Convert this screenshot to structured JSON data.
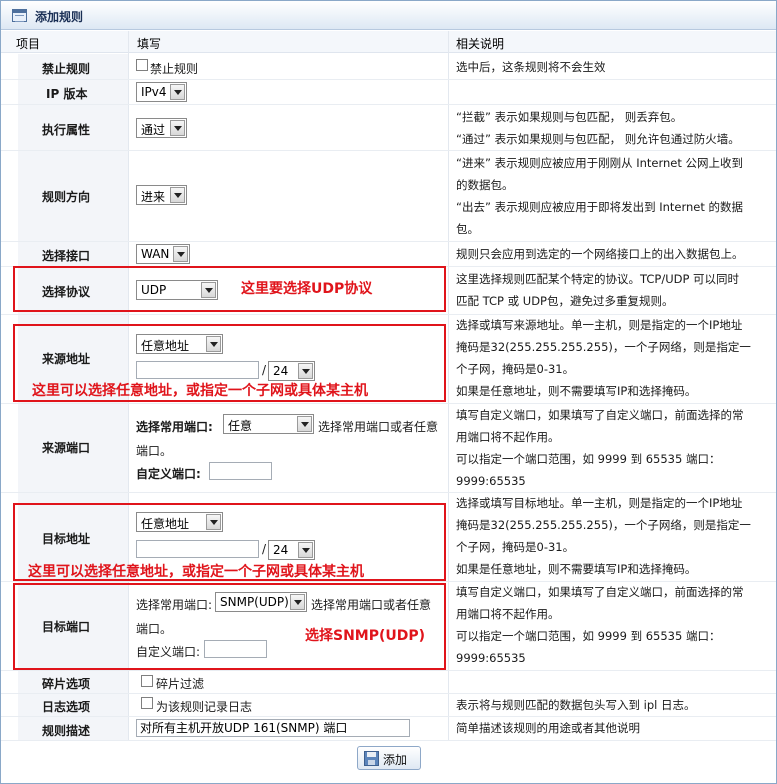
{
  "window": {
    "title": "添加规则"
  },
  "columns": {
    "item": "项目",
    "fill": "填写",
    "desc": "相关说明"
  },
  "rows": {
    "disable": {
      "label": "禁止规则",
      "checkbox_label": "禁止规则",
      "checked": false,
      "desc": [
        "选中后，这条规则将不会生效"
      ]
    },
    "ipversion": {
      "label": "IP 版本",
      "value": "IPv4"
    },
    "action": {
      "label": "执行属性",
      "value": "通过",
      "desc": [
        "“拦截” 表示如果规则与包匹配， 则丢弃包。",
        "“通过” 表示如果规则与包匹配， 则允许包通过防火墙。"
      ]
    },
    "direction": {
      "label": "规则方向",
      "value": "进来",
      "desc": [
        "“进来” 表示规则应被应用于刚刚从 Internet 公网上收到",
        "的数据包。",
        "“出去” 表示规则应被应用于即将发出到 Internet 的数据",
        "包。"
      ]
    },
    "interface": {
      "label": "选择接口",
      "value": "WAN",
      "desc": [
        "规则只会应用到选定的一个网络接口上的出入数据包上。"
      ]
    },
    "protocol": {
      "label": "选择协议",
      "value": "UDP",
      "desc": [
        "这里选择规则匹配某个特定的协议。TCP/UDP 可以同时",
        "匹配 TCP 或 UDP包，避免过多重复规则。"
      ]
    },
    "source": {
      "label": "来源地址",
      "value": "任意地址",
      "mask": "24",
      "slash": "/",
      "desc": [
        "选择或填写来源地址。单一主机，则是指定的一个IP地址",
        "掩码是32(255.255.255.255)，一个子网络，则是指定一",
        "个子网，掩码是0-31。",
        "如果是任意地址，则不需要填写IP和选择掩码。"
      ]
    },
    "source_port": {
      "label": "来源端口",
      "common_label": "选择常用端口:",
      "value": "任意",
      "hint_a": "选择常用端口或者任意",
      "hint_b": "端口。",
      "custom_label": "自定义端口:",
      "desc": [
        "填写自定义端口，如果填写了自定义端口，前面选择的常",
        "用端口将不起作用。",
        "可以指定一个端口范围，如 9999 到 65535 端口：",
        "9999:65535"
      ]
    },
    "dest": {
      "label": "目标地址",
      "value": "任意地址",
      "mask": "24",
      "slash": "/",
      "desc": [
        "选择或填写目标地址。单一主机，则是指定的一个IP地址",
        "掩码是32(255.255.255.255)，一个子网络，则是指定一",
        "个子网，掩码是0-31。",
        "如果是任意地址，则不需要填写IP和选择掩码。"
      ]
    },
    "dest_port": {
      "label": "目标端口",
      "common_label": "选择常用端口:",
      "value": "SNMP(UDP)",
      "hint_a": "选择常用端口或者任意",
      "hint_b": "端口。",
      "custom_label": "自定义端口:",
      "desc": [
        "填写自定义端口，如果填写了自定义端口，前面选择的常",
        "用端口将不起作用。",
        "可以指定一个端口范围，如 9999 到 65535 端口：",
        "9999:65535"
      ]
    },
    "fragment": {
      "label": "碎片选项",
      "checkbox_label": "碎片过滤",
      "checked": false
    },
    "log": {
      "label": "日志选项",
      "checkbox_label": "为该规则记录日志",
      "checked": false,
      "desc": [
        "表示将与规则匹配的数据包头写入到 ipl 日志。"
      ]
    },
    "description": {
      "label": "规则描述",
      "value": "对所有主机开放UDP 161(SNMP) 端口",
      "desc": [
        "简单描述该规则的用途或者其他说明"
      ]
    }
  },
  "annotations": {
    "protocol": "这里要选择UDP协议",
    "source": "这里可以选择任意地址，或指定一个子网或具体某主机",
    "dest": "这里可以选择任意地址，或指定一个子网或具体某主机",
    "dest_port": "选择SNMP(UDP)"
  },
  "buttons": {
    "add": "添加"
  },
  "colors": {
    "annotation": "#e0141b",
    "border": "#8aa8c8"
  }
}
